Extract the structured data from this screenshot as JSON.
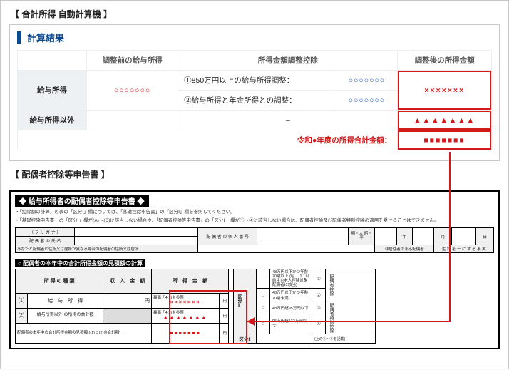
{
  "calculator": {
    "section_label": "【 合計所得 自動計算機 】",
    "result_title": "計算結果",
    "columns": {
      "before": "調整前の給与所得",
      "adjust": "所得金額調整控除",
      "after": "調整後の所得金額"
    },
    "rows": {
      "salary_label": "給与所得",
      "salary_before": "○○○○○○○",
      "adj1_label": "①850万円以上の給与所得調整：",
      "adj1_val": "○○○○○○○",
      "adj2_label": "②給与所得と年金所得との調整：",
      "adj2_val": "○○○○○○○",
      "after_x": "×××××××",
      "other_label": "給与所得以外",
      "other_mid": "–",
      "other_after": "▲▲▲▲▲▲▲",
      "total_label": "令和●年度の所得合計金額：",
      "total_val": "■■■■■■■"
    }
  },
  "form": {
    "section_label": "【 配偶者控除等申告書 】",
    "head": "◆ 給与所得者の配偶者控除等申告書 ◆",
    "note1": "・「控除額の計算」の表の「区分Ⅰ」欄については、「基礎控除申告書」の「区分Ⅰ」欄を参照してください。",
    "note2": "・「基礎控除申告書」の「区分Ⅰ」欄が(A)～(C)に該当しない場合や、「配偶者控除等申告書」の「区分Ⅱ」欄が①～④に該当しない場合は、配偶者控除及び配偶者特別控除の適用を受けることはできません。",
    "name_block": {
      "furigana": "（ フ リ ガ ナ ）",
      "name_label": "配 偶 者 の 氏 名",
      "addr_label": "配 偶 者 の 個 人 番 号",
      "addr_hint": "あなたと配偶者の住所又は居所が異なる場合の配偶者の住所又は居所",
      "birth_hdr": "明・大\n昭・平",
      "birth_unit_y": "年",
      "birth_unit_m": "月",
      "birth_unit_d": "日",
      "elderly": "非居住者である配偶者",
      "exist": "生 計 を 一 に す る 事 実"
    },
    "income_block": {
      "head": "○ 配偶者の本年中の合計所得金額の見積額の計算",
      "col_type": "所 得 の 種 類",
      "col_rev": "収　入　金　額",
      "col_inc": "所　得　金　額",
      "row1_no": "(1)",
      "row1_label": "給　与　所　得",
      "row1_hint": "裏面「4(1)を参照」",
      "row1_val": "×××××××",
      "row2_no": "(2)",
      "row2_label": "給与所得以外\nの所得の合計額",
      "row2_hint": "裏面「4(2)を参照」",
      "row2_val": "▲▲▲▲▲▲▲",
      "total_label": "配偶者の本年中の合計所得金額の見積額\n((1)と(2)の合計額)",
      "total_val": "■■■■■■■",
      "yen": "円"
    },
    "division": {
      "hdr_div": "区分Ⅱ",
      "opt1": "48万円以下かつ年齢70歳以上\n(昭　.1.1以前生)\n(老人控除対象配偶者に該当)",
      "opt1_no": "①",
      "opt2": "48万円以下かつ年齢70歳未満",
      "opt2_no": "②",
      "opt3": "48万円超95万円以下",
      "opt3_no": "③",
      "opt4": "95万円超133万円以下",
      "opt4_no": "④",
      "footer_l": "区分Ⅱ",
      "footer_r": "(上の①～④を記載)",
      "side": "配偶者控除",
      "side2": "配偶者特別控除"
    }
  }
}
